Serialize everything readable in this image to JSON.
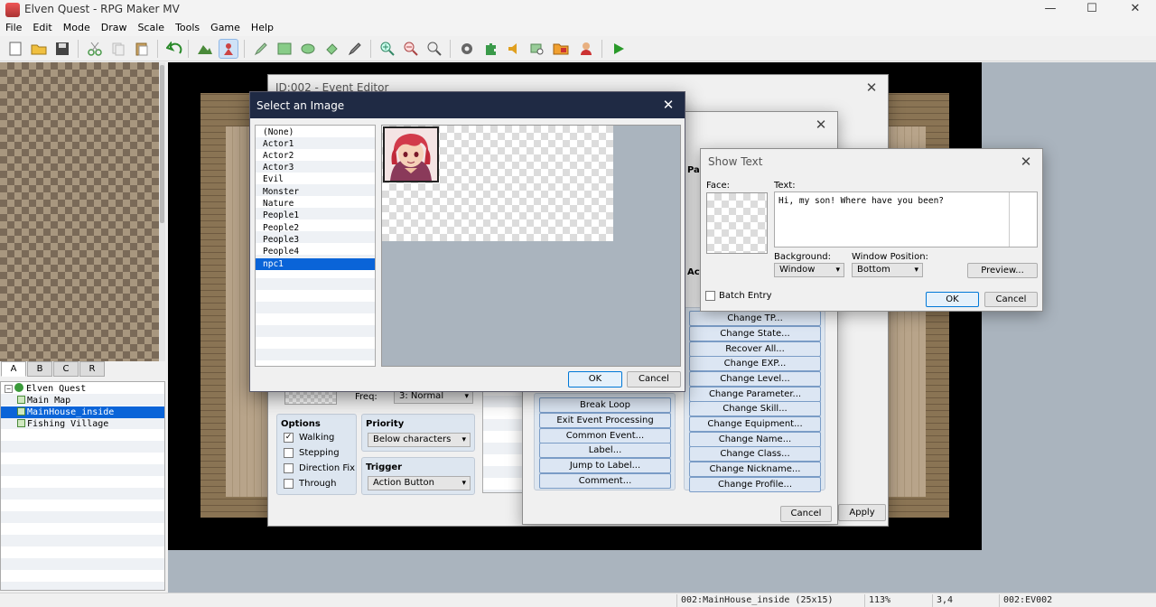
{
  "window": {
    "title": "Elven Quest - RPG Maker MV",
    "minimize": "—",
    "maximize": "☐",
    "close": "✕"
  },
  "menu": [
    "File",
    "Edit",
    "Mode",
    "Draw",
    "Scale",
    "Tools",
    "Game",
    "Help"
  ],
  "tileset_tabs": [
    "A",
    "B",
    "C",
    "R"
  ],
  "map_tree": [
    {
      "label": "Elven Quest",
      "level": 0,
      "selected": false
    },
    {
      "label": "Main Map",
      "level": 1,
      "selected": false
    },
    {
      "label": "MainHouse_inside",
      "level": 1,
      "selected": true
    },
    {
      "label": "Fishing Village",
      "level": 1,
      "selected": false
    }
  ],
  "status": {
    "map": "002:MainHouse_inside (25x15)",
    "zoom": "113%",
    "coords": "3,4",
    "event": "002:EV002"
  },
  "event_editor": {
    "title": "ID:002 - Event Editor",
    "freq_label": "Freq:",
    "freq_value": "3: Normal",
    "options_title": "Options",
    "options": [
      {
        "label": "Walking",
        "checked": true
      },
      {
        "label": "Stepping",
        "checked": false
      },
      {
        "label": "Direction Fix",
        "checked": false
      },
      {
        "label": "Through",
        "checked": false
      }
    ],
    "priority_title": "Priority",
    "priority_value": "Below characters",
    "trigger_title": "Trigger",
    "trigger_value": "Action Button",
    "cancel": "Cancel",
    "apply": "Apply"
  },
  "event_commands": {
    "col1_header": "Par",
    "col2_header": "Act",
    "left_buttons": [
      "Break Loop",
      "Exit Event Processing",
      "Common Event...",
      "Label...",
      "Jump to Label...",
      "Comment..."
    ],
    "right_buttons": [
      "Change TP...",
      "Change State...",
      "Recover All...",
      "Change EXP...",
      "Change Level...",
      "Change Parameter...",
      "Change Skill...",
      "Change Equipment...",
      "Change Name...",
      "Change Class...",
      "Change Nickname...",
      "Change Profile..."
    ]
  },
  "select_image": {
    "title": "Select an Image",
    "items": [
      "(None)",
      "Actor1",
      "Actor2",
      "Actor3",
      "Evil",
      "Monster",
      "Nature",
      "People1",
      "People2",
      "People3",
      "People4",
      "npc1"
    ],
    "selected_index": 11,
    "ok": "OK",
    "cancel": "Cancel"
  },
  "show_text": {
    "title": "Show Text",
    "face_label": "Face:",
    "text_label": "Text:",
    "text_value": "Hi, my son! Where have you been?",
    "background_label": "Background:",
    "background_value": "Window",
    "position_label": "Window Position:",
    "position_value": "Bottom",
    "preview": "Preview...",
    "batch_entry": "Batch Entry",
    "ok": "OK",
    "cancel": "Cancel"
  }
}
